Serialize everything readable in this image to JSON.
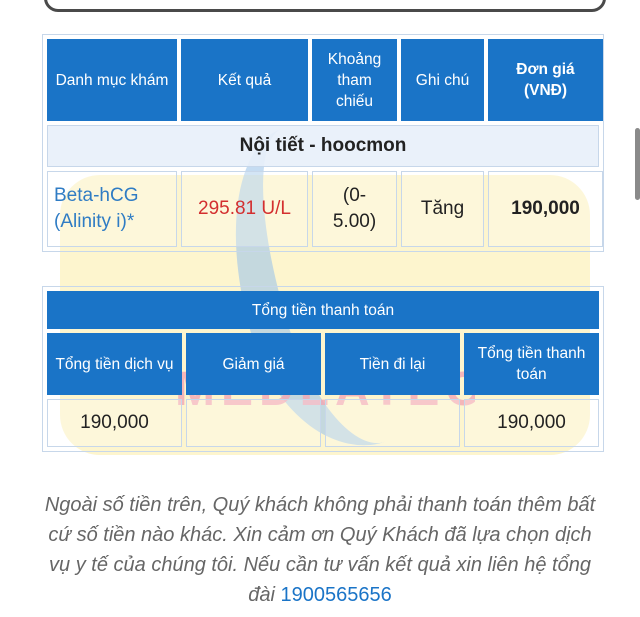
{
  "watermark": {
    "text": "MEDLATEC"
  },
  "exam_table": {
    "headers": [
      "Danh mục khám",
      "Kết quả",
      "Khoảng tham chiếu",
      "Ghi chú",
      "Đơn giá (VNĐ)"
    ],
    "section_title": "Nội tiết - hoocmon",
    "row": {
      "test_name": "Beta-hCG (Alinity i)*",
      "result": "295.81 U/L",
      "reference_range": "(0-5.00)",
      "note": "Tăng",
      "price": "190,000"
    }
  },
  "payment_table": {
    "title": "Tổng tiền thanh toán",
    "headers": [
      "Tổng tiền dịch vụ",
      "Giảm giá",
      "Tiền đi lại",
      "Tổng tiền thanh toán"
    ],
    "values": [
      "190,000",
      "",
      "",
      "190,000"
    ]
  },
  "footer": {
    "message": "Ngoài số tiền trên, Quý khách không phải thanh toán thêm bất cứ số tiền nào khác. Xin cảm ơn Quý Khách đã lựa chọn dịch vụ y tế của chúng tôi. Nếu cần tư vấn kết quả xin liên hệ tổng đài",
    "phone": "1900565656"
  },
  "colors": {
    "header_blue": "#1a74c7",
    "result_red": "#d32f2f",
    "link_blue": "#2f7cc4"
  }
}
